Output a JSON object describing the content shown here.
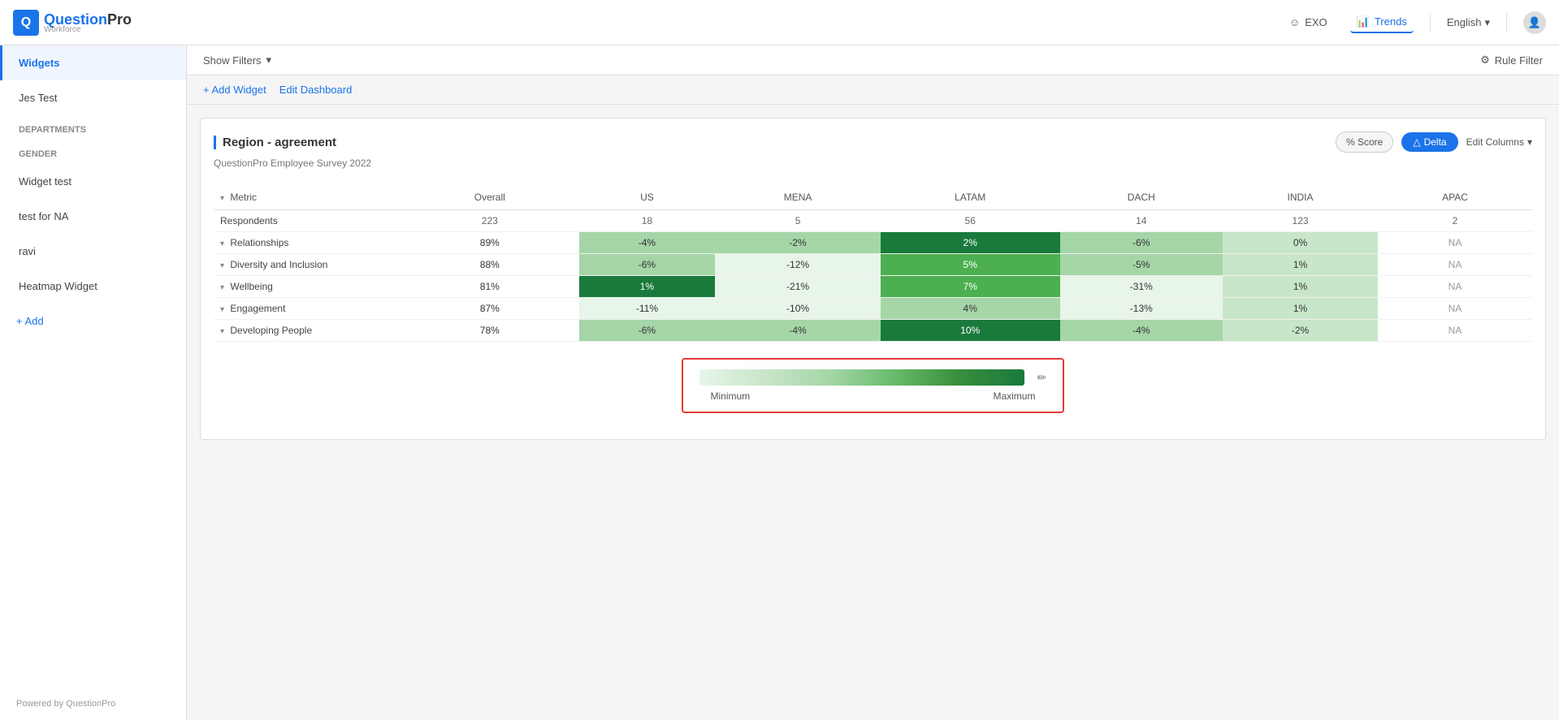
{
  "navbar": {
    "logo_question": "Question",
    "logo_pro": "Pro",
    "logo_sub": "Workforce",
    "exo_label": "EXO",
    "trends_label": "Trends",
    "lang_label": "English",
    "lang_arrow": "▾"
  },
  "filter_bar": {
    "show_filters": "Show Filters",
    "show_filters_arrow": "▾",
    "rule_filter": "Rule Filter"
  },
  "toolbar": {
    "add_widget": "+ Add Widget",
    "edit_dashboard": "Edit Dashboard"
  },
  "sidebar": {
    "items": [
      {
        "id": "widgets",
        "label": "Widgets",
        "active": true
      },
      {
        "id": "jes-test",
        "label": "Jes Test"
      },
      {
        "id": "departments",
        "label": "DEPARTMENTS",
        "is_header": false
      },
      {
        "id": "gender",
        "label": "GENDER"
      },
      {
        "id": "widget-test",
        "label": "Widget test"
      },
      {
        "id": "test-for-na",
        "label": "test for NA"
      },
      {
        "id": "ravi",
        "label": "ravi"
      },
      {
        "id": "heatmap-widget",
        "label": "Heatmap Widget"
      }
    ],
    "add_label": "+ Add",
    "footer": "Powered by QuestionPro"
  },
  "widget": {
    "title": "Region - agreement",
    "survey": "QuestionPro Employee Survey 2022",
    "score_btn": "% Score",
    "delta_btn": "△ Delta",
    "edit_columns": "Edit Columns",
    "table": {
      "columns": [
        "Metric",
        "Overall",
        "US",
        "MENA",
        "LATAM",
        "DACH",
        "INDIA",
        "APAC"
      ],
      "rows": [
        {
          "type": "respondents",
          "metric": "Respondents",
          "values": [
            "223",
            "18",
            "5",
            "56",
            "14",
            "123",
            "2"
          ]
        },
        {
          "type": "data",
          "metric": "Relationships",
          "has_chevron": true,
          "overall": "89%",
          "values": [
            "-4%",
            "-2%",
            "2%",
            "-6%",
            "0%",
            "NA"
          ],
          "colors": [
            "light-green",
            "light-green",
            "dark-green",
            "light-green",
            "very-light-green",
            "na"
          ]
        },
        {
          "type": "data",
          "metric": "Diversity and Inclusion",
          "has_chevron": true,
          "overall": "88%",
          "values": [
            "-6%",
            "-12%",
            "5%",
            "-5%",
            "1%",
            "NA"
          ],
          "colors": [
            "light-green",
            "pale-green",
            "medium-green",
            "light-green",
            "very-light-green",
            "na"
          ]
        },
        {
          "type": "data",
          "metric": "Wellbeing",
          "has_chevron": true,
          "overall": "81%",
          "values": [
            "1%",
            "-21%",
            "7%",
            "-31%",
            "1%",
            "NA"
          ],
          "colors": [
            "dark-green",
            "pale-green",
            "medium-green",
            "pale-green",
            "very-light-green",
            "na"
          ]
        },
        {
          "type": "data",
          "metric": "Engagement",
          "has_chevron": true,
          "overall": "87%",
          "values": [
            "-11%",
            "-10%",
            "4%",
            "-13%",
            "1%",
            "NA"
          ],
          "colors": [
            "pale-green",
            "pale-green",
            "light-green",
            "pale-green",
            "very-light-green",
            "na"
          ]
        },
        {
          "type": "data",
          "metric": "Developing People",
          "has_chevron": true,
          "overall": "78%",
          "values": [
            "-6%",
            "-4%",
            "10%",
            "-4%",
            "-2%",
            "NA"
          ],
          "colors": [
            "light-green",
            "light-green",
            "dark-green",
            "light-green",
            "very-light-green",
            "na"
          ]
        }
      ]
    }
  },
  "legend": {
    "minimum": "Minimum",
    "maximum": "Maximum",
    "edit_icon": "✏"
  }
}
